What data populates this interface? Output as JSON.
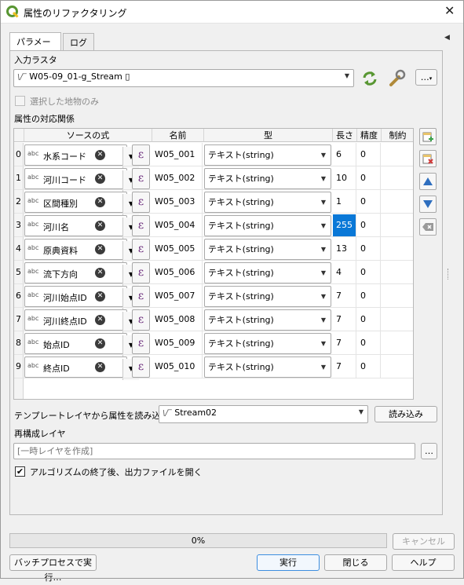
{
  "window": {
    "title": "属性のリファクタリング",
    "app_icon": "qgis-icon",
    "close_glyph": "✕"
  },
  "tabs": [
    {
      "label": "パラメータ",
      "active": true
    },
    {
      "label": "ログ",
      "active": false
    }
  ],
  "input_raster": {
    "label": "入力ラスタ",
    "layer_glyph": "\\/‾",
    "value": "W05-09_01-g_Stream ▯",
    "more_button": "…"
  },
  "selected_only": {
    "label": "選択した地物のみ",
    "checked": false
  },
  "mapping": {
    "label": "属性の対応関係",
    "headers": {
      "expression": "ソースの式",
      "name": "名前",
      "type": "型",
      "length": "長さ",
      "precision": "精度",
      "constraints": "制約"
    },
    "abc_glyph": "abc",
    "clear_glyph": "✕",
    "epsilon_glyph": "ε",
    "rows": [
      {
        "index": "0",
        "expression": "水系コード",
        "name": "W05_001",
        "type": "テキスト(string)",
        "length": "6",
        "precision": "0"
      },
      {
        "index": "1",
        "expression": "河川コード",
        "name": "W05_002",
        "type": "テキスト(string)",
        "length": "10",
        "precision": "0"
      },
      {
        "index": "2",
        "expression": "区間種別",
        "name": "W05_003",
        "type": "テキスト(string)",
        "length": "1",
        "precision": "0"
      },
      {
        "index": "3",
        "expression": "河川名",
        "name": "W05_004",
        "type": "テキスト(string)",
        "length": "255",
        "precision": "0",
        "selected_length": true
      },
      {
        "index": "4",
        "expression": "原典資料",
        "name": "W05_005",
        "type": "テキスト(string)",
        "length": "13",
        "precision": "0"
      },
      {
        "index": "5",
        "expression": "流下方向",
        "name": "W05_006",
        "type": "テキスト(string)",
        "length": "4",
        "precision": "0"
      },
      {
        "index": "6",
        "expression": "河川始点ID",
        "name": "W05_007",
        "type": "テキスト(string)",
        "length": "7",
        "precision": "0"
      },
      {
        "index": "7",
        "expression": "河川終点ID",
        "name": "W05_008",
        "type": "テキスト(string)",
        "length": "7",
        "precision": "0"
      },
      {
        "index": "8",
        "expression": "始点ID",
        "name": "W05_009",
        "type": "テキスト(string)",
        "length": "7",
        "precision": "0"
      },
      {
        "index": "9",
        "expression": "終点ID",
        "name": "W05_010",
        "type": "テキスト(string)",
        "length": "7",
        "precision": "0"
      }
    ]
  },
  "template_layer": {
    "label": "テンプレートレイヤから属性を読み込む",
    "layer_glyph": "\\/‾",
    "value": "Stream02",
    "load_button": "読み込み"
  },
  "output": {
    "label": "再構成レイヤ",
    "placeholder": "[一時レイヤを作成]",
    "browse_button": "…"
  },
  "open_output": {
    "label": "アルゴリズムの終了後、出力ファイルを開く",
    "checked": true,
    "check_glyph": "✔"
  },
  "progress": {
    "value_text": "0%",
    "percent": 0
  },
  "buttons": {
    "cancel": "キャンセル",
    "batch": "バッチプロセスで実行…",
    "run": "実行",
    "close": "閉じる",
    "help": "ヘルプ"
  },
  "colors": {
    "selection": "#0a78d7",
    "primary_border": "#3d8ee0",
    "qgis_green": "#589632",
    "qgis_yellow": "#f0c020",
    "arrow_blue": "#2f6fbf"
  }
}
